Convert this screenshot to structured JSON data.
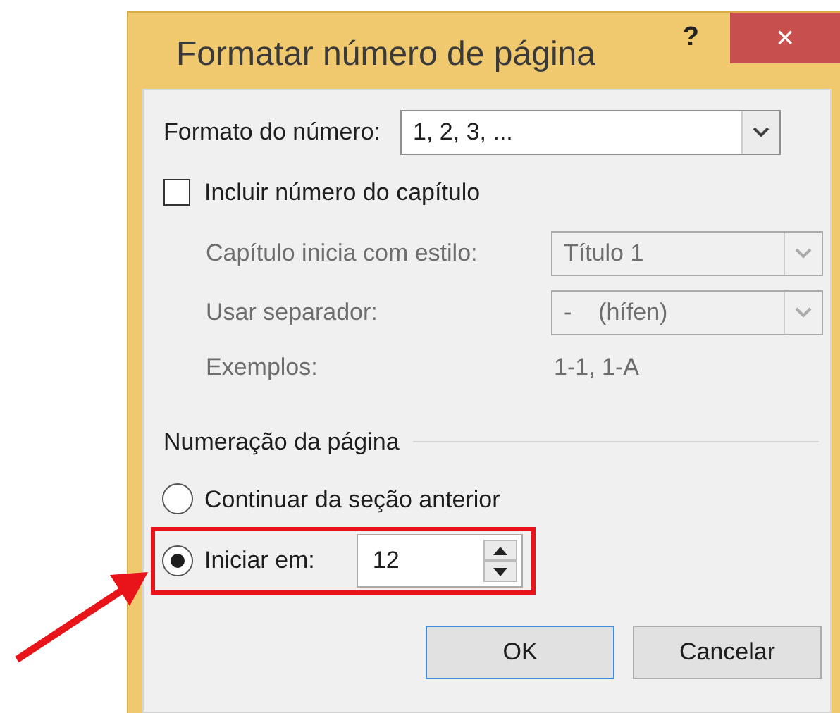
{
  "window": {
    "title": "Formatar número de página",
    "help": "?",
    "close": "×"
  },
  "number_format": {
    "label": "Formato do número:",
    "value": "1, 2, 3, ..."
  },
  "include_chapter": {
    "label": "Incluir número do capítulo",
    "checked": false
  },
  "chapter_fields": [
    {
      "kind": "select",
      "label": "Capítulo inicia com estilo:",
      "value": "Título 1",
      "disabled": true
    },
    {
      "kind": "select",
      "label": "Usar separador:",
      "value": "-    (hífen)",
      "disabled": true
    },
    {
      "kind": "text",
      "label": "Exemplos:",
      "value": "1-1, 1-A",
      "disabled": true
    }
  ],
  "page_numbering": {
    "heading": "Numeração da página",
    "options": [
      {
        "kind": "radio",
        "label": "Continuar da seção anterior",
        "selected": false,
        "highlighted": false
      },
      {
        "kind": "spin",
        "label": "Iniciar em:",
        "value": "12",
        "selected": true,
        "highlighted": true
      }
    ]
  },
  "buttons": [
    {
      "label": "OK",
      "default": true
    },
    {
      "label": "Cancelar",
      "default": false
    }
  ]
}
